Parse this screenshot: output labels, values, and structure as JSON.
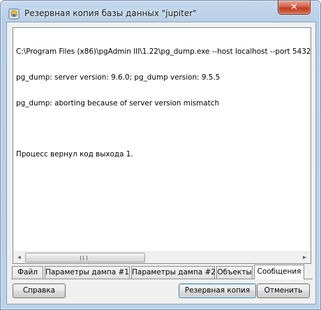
{
  "window": {
    "title": "Резервная копия базы данных \"jupiter\"",
    "close_glyph": "✕"
  },
  "log": {
    "lines": [
      "C:\\Program Files (x86)\\pgAdmin III\\1.22\\pg_dump.exe --host localhost --port 5432",
      "pg_dump: server version: 9.6.0; pg_dump version: 9.5.5",
      "pg_dump: aborting because of server version mismatch",
      "",
      "Процесс вернул код выхода 1."
    ]
  },
  "scrollbar": {
    "left_arrow": "◄",
    "right_arrow": "►"
  },
  "tabs": [
    {
      "label": "Файл"
    },
    {
      "label": "Параметры дампа #1"
    },
    {
      "label": "Параметры дампа #2"
    },
    {
      "label": "Объекты"
    },
    {
      "label": "Сообщения"
    }
  ],
  "active_tab": "Сообщения",
  "buttons": {
    "help": "Справка",
    "backup": "Резервная копия",
    "cancel": "Отменить"
  }
}
